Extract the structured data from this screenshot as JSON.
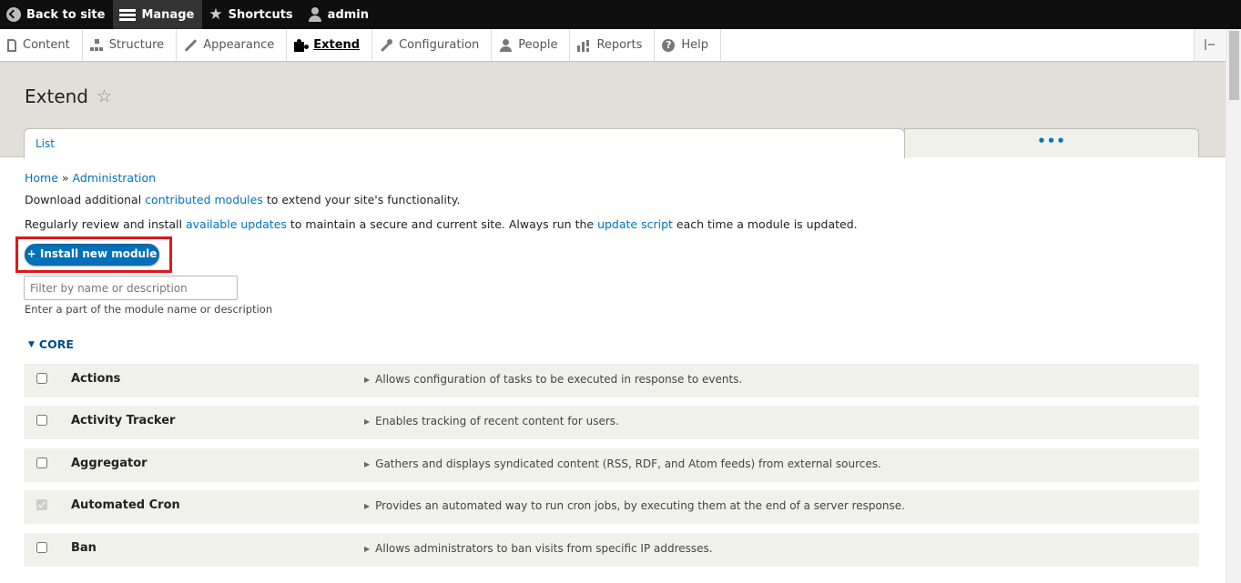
{
  "toolbar": {
    "back_label": "Back to site",
    "manage_label": "Manage",
    "shortcuts_label": "Shortcuts",
    "user_label": "admin"
  },
  "tray": {
    "items": [
      {
        "label": "Content",
        "icon": "document-icon"
      },
      {
        "label": "Structure",
        "icon": "structure-icon"
      },
      {
        "label": "Appearance",
        "icon": "brush-icon"
      },
      {
        "label": "Extend",
        "icon": "puzzle-icon",
        "active": true
      },
      {
        "label": "Configuration",
        "icon": "wrench-icon"
      },
      {
        "label": "People",
        "icon": "people-icon"
      },
      {
        "label": "Reports",
        "icon": "bar-chart-icon"
      },
      {
        "label": "Help",
        "icon": "help-icon"
      }
    ]
  },
  "page": {
    "title": "Extend",
    "tabs": {
      "list": "List",
      "more": "•••"
    }
  },
  "breadcrumb": {
    "home": "Home",
    "separator": "»",
    "admin": "Administration"
  },
  "help": {
    "l1_pre": "Download additional ",
    "l1_link": "contributed modules",
    "l1_post": " to extend your site's functionality.",
    "l2_pre": "Regularly review and install ",
    "l2_link1": "available updates",
    "l2_mid": " to maintain a secure and current site. Always run the ",
    "l2_link2": "update script",
    "l2_post": " each time a module is updated."
  },
  "install_button": "+ Install new module",
  "filter": {
    "placeholder": "Filter by name or description",
    "value": "",
    "description": "Enter a part of the module name or description"
  },
  "package": {
    "label": "CORE",
    "arrow": "▼"
  },
  "modules": [
    {
      "name": "Actions",
      "description": "Allows configuration of tasks to be executed in response to events.",
      "checked": false,
      "disabled": false
    },
    {
      "name": "Activity Tracker",
      "description": "Enables tracking of recent content for users.",
      "checked": false,
      "disabled": false
    },
    {
      "name": "Aggregator",
      "description": "Gathers and displays syndicated content (RSS, RDF, and Atom feeds) from external sources.",
      "checked": false,
      "disabled": false
    },
    {
      "name": "Automated Cron",
      "description": "Provides an automated way to run cron jobs, by executing them at the end of a server response.",
      "checked": true,
      "disabled": true
    },
    {
      "name": "Ban",
      "description": "Allows administrators to ban visits from specific IP addresses.",
      "checked": false,
      "disabled": false
    }
  ],
  "colors": {
    "accent": "#0074bd",
    "highlight": "#e0161b",
    "button": "#0071b8"
  }
}
